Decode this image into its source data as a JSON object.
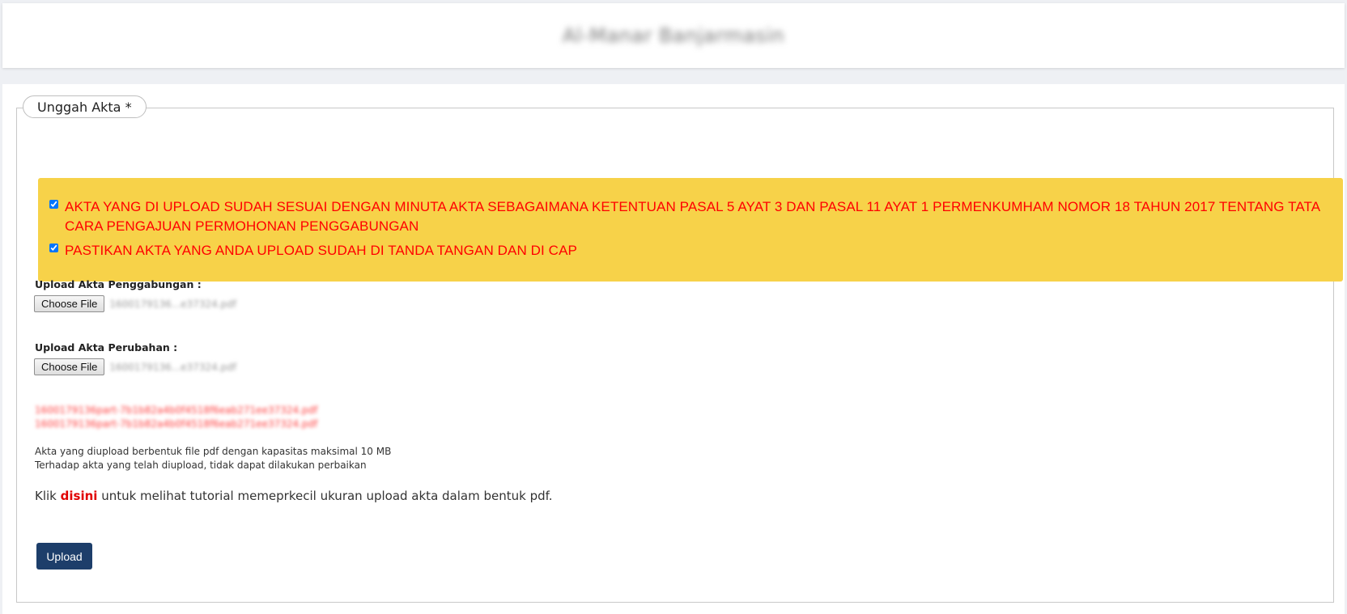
{
  "header": {
    "title": "Al-Manar Banjarmasin"
  },
  "section": {
    "legend": "Unggah Akta *"
  },
  "notice": {
    "items": [
      {
        "checked": true,
        "text": "AKTA YANG DI UPLOAD SUDAH SESUAI DENGAN MINUTA AKTA SEBAGAIMANA KETENTUAN PASAL 5 AYAT 3 DAN PASAL 11 AYAT 1 PERMENKUMHAM NOMOR 18 TAHUN 2017 TENTANG TATA CARA PENGAJUAN PERMOHONAN PENGGABUNGAN"
      },
      {
        "checked": true,
        "text": "PASTIKAN AKTA YANG ANDA UPLOAD SUDAH DI TANDA TANGAN DAN DI CAP"
      }
    ]
  },
  "uploads": [
    {
      "label": "Upload Akta Penggabungan :",
      "button": "Choose File",
      "file_name": "1600179136...e37324.pdf"
    },
    {
      "label": "Upload Akta Perubahan :",
      "button": "Choose File",
      "file_name": "1600179136...e37324.pdf"
    }
  ],
  "uploaded_files": [
    "1600179136part-7b1b82a4b0f4518f6eab271ee37324.pdf",
    "1600179136part-7b1b82a4b0f4518f6eab271ee37324.pdf"
  ],
  "info": {
    "line1": "Akta yang diupload berbentuk file pdf dengan kapasitas maksimal 10 MB",
    "line2": "Terhadap akta yang telah diupload, tidak dapat dilakukan perbaikan"
  },
  "tutorial": {
    "prefix": "Klik ",
    "link": "disini",
    "suffix": " untuk melihat tutorial memeprkecil ukuran upload akta dalam bentuk pdf."
  },
  "actions": {
    "upload_label": "Upload"
  },
  "colors": {
    "notice_bg": "#f7d249",
    "notice_text": "#ff0000",
    "upload_button": "#1d3e6a",
    "link": "#e10000"
  }
}
